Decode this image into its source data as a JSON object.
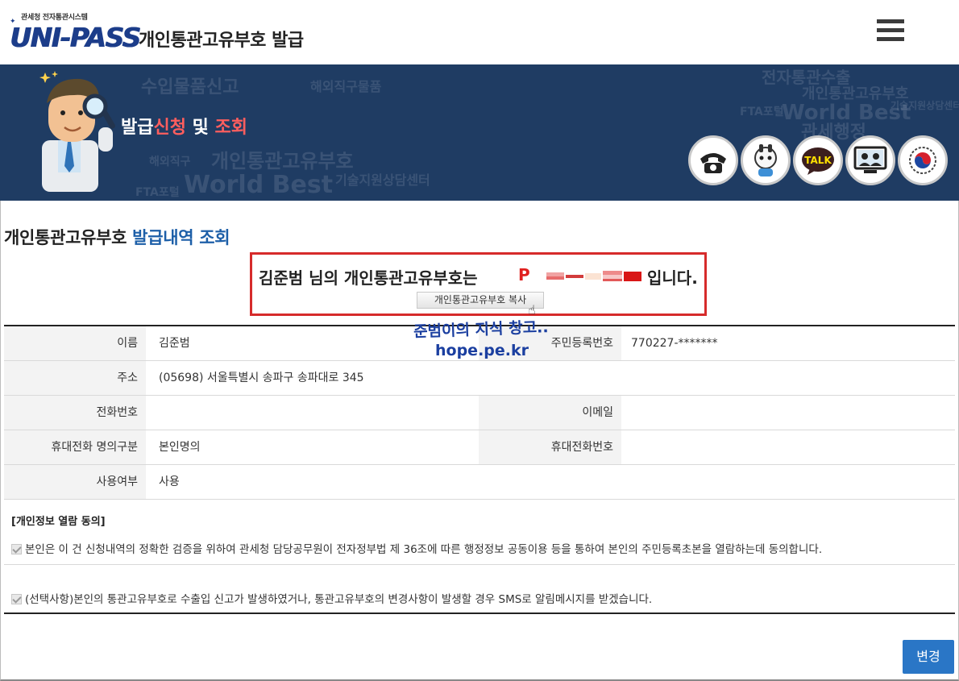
{
  "header": {
    "logo_sub": "관세청 전자통관시스템",
    "logo_main": "UNI-PASS",
    "title": "개인통관고유부호 발급"
  },
  "banner": {
    "title_part1": "발급",
    "title_part2": "신청",
    "title_part3": " 및 ",
    "title_part4": "조회",
    "icon_talk_label": "TALK",
    "icons": [
      "phone-icon",
      "chatbot-icon",
      "kakao-talk-icon",
      "remote-support-icon",
      "government-emblem-icon"
    ]
  },
  "section": {
    "title_black": "개인통관고유부호 ",
    "title_blue": "발급내역 조회"
  },
  "result": {
    "prefix": "김준범 님의 개인통관고유부호는",
    "code_start": "P",
    "suffix": "입니다.",
    "copy_button": "개인통관고유부호 복사"
  },
  "watermark": {
    "line1": "준범이의 지식 창고..",
    "line2": "hope.pe.kr"
  },
  "info": {
    "name_label": "이름",
    "name_value": "김준범",
    "rrn_label": "주민등록번호",
    "rrn_value": "770227-*******",
    "address_label": "주소",
    "address_value": "(05698)  서울특별시 송파구 송파대로 345",
    "phone_label": "전화번호",
    "phone_value": "",
    "email_label": "이메일",
    "email_value": "",
    "mobile_owner_label": "휴대전화 명의구분",
    "mobile_owner_value": "본인명의",
    "mobile_label": "휴대전화번호",
    "mobile_value": "",
    "usage_label": "사용여부",
    "usage_value": "사용"
  },
  "consent": {
    "title": "[개인정보 열람 동의]",
    "item1": "본인은 이 건 신청내역의 정확한 검증을 위하여 관세청 담당공무원이 전자정부법 제 36조에 따른 행정정보 공동이용 등을 통하여 본인의 주민등록초본을 열람하는데 동의합니다.",
    "item2": "(선택사항)본인의 통관고유부호로 수출입 신고가 발생하였거나, 통관고유부호의 변경사항이 발생할 경우 SMS로 알림메시지를 받겠습니다."
  },
  "actions": {
    "change_button": "변경"
  },
  "colors": {
    "banner_bg": "#1f3c63",
    "highlight_red": "#ff5e5e",
    "title_blue": "#1d5fa8",
    "button_blue": "#2a76c6",
    "box_red": "#d62b2b"
  }
}
